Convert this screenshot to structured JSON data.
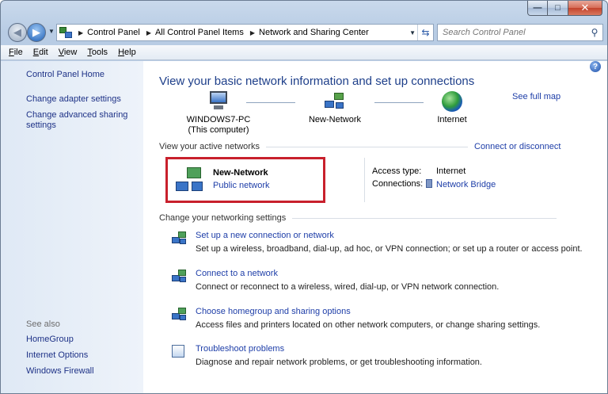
{
  "window": {
    "caption": {
      "minimize": "—",
      "maximize": "□",
      "close": "✕"
    }
  },
  "address_bar": {
    "breadcrumbs": [
      "Control Panel",
      "All Control Panel Items",
      "Network and Sharing Center"
    ],
    "search_placeholder": "Search Control Panel"
  },
  "menu": [
    "File",
    "Edit",
    "View",
    "Tools",
    "Help"
  ],
  "sidebar": {
    "home": "Control Panel Home",
    "links": [
      "Change adapter settings",
      "Change advanced sharing settings"
    ],
    "see_also_label": "See also",
    "see_also": [
      "HomeGroup",
      "Internet Options",
      "Windows Firewall"
    ]
  },
  "main": {
    "title": "View your basic network information and set up connections",
    "see_full_map": "See full map",
    "map": {
      "computer": "WINDOWS7-PC",
      "computer_sub": "(This computer)",
      "network": "New-Network",
      "internet": "Internet"
    },
    "active": {
      "heading": "View your active networks",
      "connect_link": "Connect or disconnect",
      "network_name": "New-Network",
      "network_type": "Public network",
      "access_type_label": "Access type:",
      "access_type_value": "Internet",
      "connections_label": "Connections:",
      "connections_value": "Network Bridge"
    },
    "settings_heading": "Change your networking settings",
    "tasks": [
      {
        "title": "Set up a new connection or network",
        "desc": "Set up a wireless, broadband, dial-up, ad hoc, or VPN connection; or set up a router or access point."
      },
      {
        "title": "Connect to a network",
        "desc": "Connect or reconnect to a wireless, wired, dial-up, or VPN network connection."
      },
      {
        "title": "Choose homegroup and sharing options",
        "desc": "Access files and printers located on other network computers, or change sharing settings."
      },
      {
        "title": "Troubleshoot problems",
        "desc": "Diagnose and repair network problems, or get troubleshooting information."
      }
    ]
  },
  "colors": {
    "link": "#1e3ea8",
    "title": "#1e3f8a",
    "highlight_border": "#c8202c"
  }
}
